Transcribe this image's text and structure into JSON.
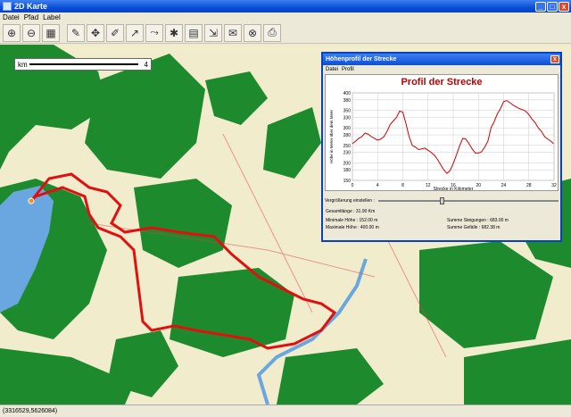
{
  "window": {
    "title": "2D Karte",
    "min": "_",
    "max": "□",
    "close": "x"
  },
  "menu": [
    "Datei",
    "Pfad",
    "Label"
  ],
  "toolbar": [
    "zoom-in-icon",
    "zoom-out-icon",
    "zoom-all-icon",
    "pin-icon",
    "pan-icon",
    "draw-point-icon",
    "draw-line-icon",
    "measure-icon",
    "close-path-icon",
    "profile-icon",
    "export-icon",
    "save-icon",
    "cancel-icon",
    "print-icon"
  ],
  "scalebar": {
    "left": "km",
    "right": "4"
  },
  "status": {
    "coords": "(3316529,5626084)"
  },
  "dialog": {
    "title": "Höhenprofil der Strecke",
    "close": "x",
    "menu": [
      "Datei",
      "Profil"
    ],
    "chart_title": "Profil der Strecke",
    "slider_label": "Vergrößerung einstellen :",
    "summary": {
      "total_length": "Gesamtlänge : 31.90 Km",
      "min_height": "Minimale Höhe : 152.00 m",
      "max_height": "Maximale Höhe : 400.00 m",
      "ascents": "Summe Steigungen : 683.00 m",
      "descents": "Summe Gefälle : 682.38 m"
    }
  },
  "chart_data": {
    "type": "line",
    "title": "Profil der Strecke",
    "xlabel": "Strecke in Kilometer",
    "ylabel": "Höhe in Meter über dem Meer",
    "xlim": [
      0,
      32
    ],
    "ylim": [
      150,
      400
    ],
    "xticks": [
      0,
      4,
      8,
      12,
      16,
      20,
      24,
      28,
      32
    ],
    "yticks": [
      150,
      180,
      200,
      230,
      250,
      280,
      300,
      330,
      350,
      380,
      400
    ],
    "series": [
      {
        "color": "#cc0000",
        "x": [
          0,
          0.5,
          1,
          1.5,
          2,
          2.5,
          3,
          3.5,
          4,
          4.5,
          5,
          5.5,
          6,
          6.5,
          7,
          7.5,
          8,
          8.5,
          9,
          9.5,
          10,
          10.5,
          11,
          11.5,
          12,
          12.5,
          13,
          13.5,
          14,
          14.5,
          15,
          15.5,
          16,
          16.5,
          17,
          17.5,
          18,
          18.5,
          19,
          19.5,
          20,
          20.5,
          21,
          21.5,
          22,
          22.5,
          23,
          23.5,
          24,
          24.5,
          25,
          25.5,
          26,
          26.5,
          27,
          27.5,
          28,
          28.5,
          29,
          29.5,
          30,
          30.5,
          31,
          31.5,
          31.9
        ],
        "y": [
          255,
          262,
          270,
          275,
          285,
          282,
          275,
          270,
          265,
          268,
          275,
          290,
          310,
          320,
          330,
          348,
          345,
          312,
          275,
          250,
          245,
          238,
          240,
          242,
          236,
          230,
          222,
          210,
          195,
          180,
          170,
          178,
          198,
          222,
          248,
          270,
          268,
          255,
          240,
          228,
          228,
          232,
          245,
          262,
          300,
          318,
          340,
          355,
          375,
          378,
          372,
          365,
          360,
          355,
          352,
          348,
          338,
          325,
          315,
          300,
          290,
          275,
          268,
          262,
          255
        ]
      }
    ]
  }
}
